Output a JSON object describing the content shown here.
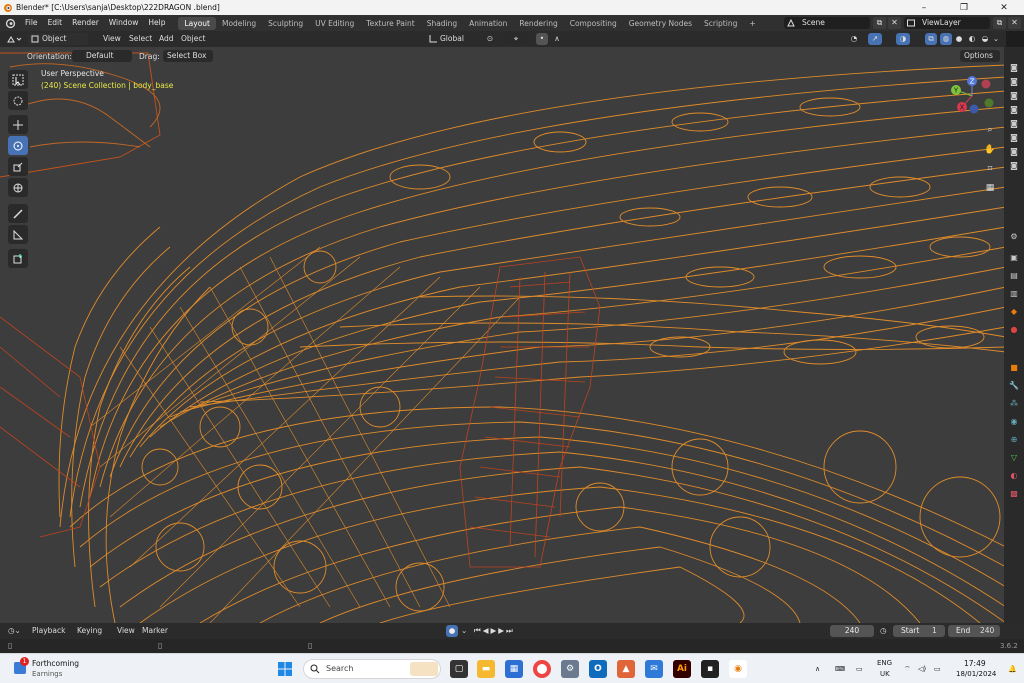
{
  "window": {
    "title": "Blender* [C:\\Users\\sanja\\Desktop\\222DRAGON .blend]",
    "controls": [
      "–",
      "❐",
      "✕"
    ]
  },
  "menu": {
    "items": [
      "File",
      "Edit",
      "Render",
      "Window",
      "Help"
    ]
  },
  "workspaces": [
    {
      "label": "Layout",
      "active": true
    },
    {
      "label": "Modeling"
    },
    {
      "label": "Sculpting"
    },
    {
      "label": "UV Editing"
    },
    {
      "label": "Texture Paint"
    },
    {
      "label": "Shading"
    },
    {
      "label": "Animation"
    },
    {
      "label": "Rendering"
    },
    {
      "label": "Compositing"
    },
    {
      "label": "Geometry Nodes"
    },
    {
      "label": "Scripting"
    },
    {
      "label": "+"
    }
  ],
  "scene": {
    "name": "Scene",
    "view_layer": "ViewLayer"
  },
  "viewport_header": {
    "mode": "Object Mode",
    "menus": [
      "View",
      "Select",
      "Add",
      "Object"
    ],
    "transform": "Global"
  },
  "tool_settings": {
    "orientation_label": "Orientation:",
    "orientation_value": "Default",
    "drag_label": "Drag:",
    "drag_value": "Select Box",
    "options": "Options"
  },
  "viewport": {
    "perspective": "User Perspective",
    "collection": "(240) Scene Collection | body_base",
    "gizmo": {
      "x": "X",
      "y": "Y",
      "z": "Z"
    },
    "colors": {
      "background": "#3d3d3d",
      "wire": "#e8902a",
      "wire_dark": "#c9541c",
      "text_yellow": "#e8e84a"
    }
  },
  "timeline": {
    "menus": [
      "Playback",
      "Keying",
      "View",
      "Marker"
    ],
    "current_frame": "240",
    "start_label": "Start",
    "start_value": "1",
    "end_label": "End",
    "end_value": "240"
  },
  "status": {
    "version": "3.6.2"
  },
  "taskbar": {
    "widget_title": "Forthcoming",
    "widget_subtitle": "Earnings",
    "widget_badge": "1",
    "search_placeholder": "Search",
    "lang_top": "ENG",
    "lang_bottom": "UK",
    "time": "17:49",
    "date": "18/01/2024"
  }
}
